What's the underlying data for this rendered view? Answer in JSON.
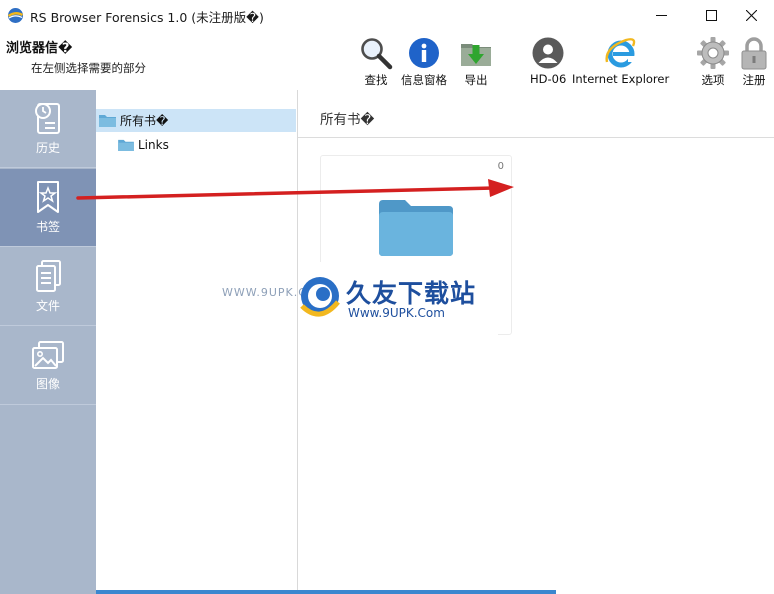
{
  "window": {
    "title": "RS Browser Forensics 1.0 (未注册版�)",
    "controls": [
      "minimize",
      "maximize",
      "close"
    ]
  },
  "header": {
    "title": "浏览器信�",
    "subtitle": "在左侧选择需要的部分"
  },
  "toolbar": {
    "find": "查找",
    "info_pane": "信息窗格",
    "export": "导出",
    "user": "HD-06",
    "browser": "Internet Explorer",
    "options": "选项",
    "register": "注册"
  },
  "sidebar": {
    "items": [
      {
        "label": "历史",
        "icon": "history-icon",
        "active": false
      },
      {
        "label": "书签",
        "icon": "bookmark-icon",
        "active": true
      },
      {
        "label": "文件",
        "icon": "files-icon",
        "active": false
      },
      {
        "label": "图像",
        "icon": "images-icon",
        "active": false
      }
    ]
  },
  "tree": {
    "root": "所有书�",
    "children": [
      "Links"
    ]
  },
  "content": {
    "title": "所有书�",
    "folder_count": "0"
  },
  "watermark": {
    "url_small": "WWW.9UPK.COM",
    "brand": "久友下载站",
    "url": "Www.9UPK.Com"
  },
  "colors": {
    "sidebar_bg": "#a9b7cb",
    "sidebar_active": "#7f93b5",
    "tree_selected": "#cce4f7",
    "folder_blue": "#5fa9d6",
    "arrow_red": "#d42020"
  }
}
